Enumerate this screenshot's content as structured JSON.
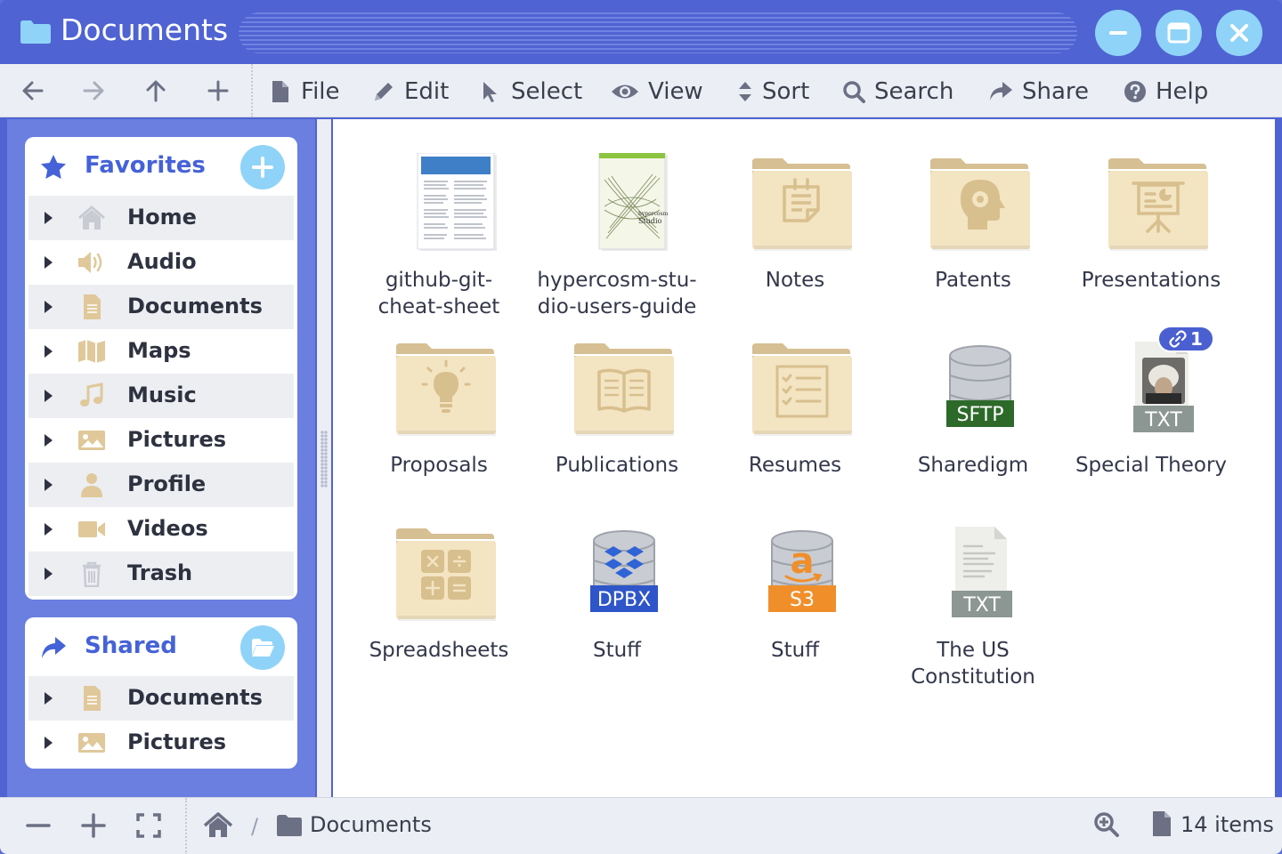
{
  "window": {
    "title": "Documents",
    "title_icon": "folder-icon",
    "controls": [
      "minimize-icon",
      "maximize-icon",
      "close-icon"
    ]
  },
  "toolbar": {
    "nav": [
      "back-icon",
      "forward-icon",
      "up-icon",
      "new-icon"
    ],
    "menus": [
      {
        "label": "File",
        "icon": "file-icon"
      },
      {
        "label": "Edit",
        "icon": "pencil-icon"
      },
      {
        "label": "Select",
        "icon": "cursor-icon"
      },
      {
        "label": "View",
        "icon": "eye-icon"
      },
      {
        "label": "Sort",
        "icon": "sort-icon"
      },
      {
        "label": "Search",
        "icon": "search-icon"
      },
      {
        "label": "Share",
        "icon": "share-icon"
      },
      {
        "label": "Help",
        "icon": "help-icon"
      }
    ]
  },
  "sidebar": {
    "favorites": {
      "title": "Favorites",
      "icon": "star-icon",
      "action_icon": "plus-icon",
      "items": [
        {
          "label": "Home",
          "icon": "home-icon"
        },
        {
          "label": "Audio",
          "icon": "speaker-icon"
        },
        {
          "label": "Documents",
          "icon": "document-icon"
        },
        {
          "label": "Maps",
          "icon": "map-icon"
        },
        {
          "label": "Music",
          "icon": "music-icon"
        },
        {
          "label": "Pictures",
          "icon": "picture-icon"
        },
        {
          "label": "Profile",
          "icon": "person-icon"
        },
        {
          "label": "Videos",
          "icon": "video-icon"
        },
        {
          "label": "Trash",
          "icon": "trash-icon"
        }
      ]
    },
    "shared": {
      "title": "Shared",
      "icon": "share-icon",
      "action_icon": "folder-open-icon",
      "items": [
        {
          "label": "Documents",
          "icon": "document-icon"
        },
        {
          "label": "Pictures",
          "icon": "picture-icon"
        }
      ]
    }
  },
  "files": [
    {
      "label": "github-git-cheat-sheet",
      "label_lines": [
        "github-git-",
        "cheat-sheet"
      ],
      "kind": "pdf-thumbnail"
    },
    {
      "label": "hypercosm-studio-users-guide",
      "label_lines": [
        "hypercosm-stu-",
        "dio-users-guide"
      ],
      "kind": "pdf-thumbnail",
      "thumb_text": [
        "hypercosm",
        "Studio"
      ]
    },
    {
      "label": "Notes",
      "label_lines": [
        "Notes"
      ],
      "kind": "folder",
      "emblem": "notes-icon"
    },
    {
      "label": "Patents",
      "label_lines": [
        "Patents"
      ],
      "kind": "folder",
      "emblem": "brain-gear-icon"
    },
    {
      "label": "Presentations",
      "label_lines": [
        "Presentations"
      ],
      "kind": "folder",
      "emblem": "presentation-icon"
    },
    {
      "label": "Proposals",
      "label_lines": [
        "Proposals"
      ],
      "kind": "folder",
      "emblem": "lightbulb-icon"
    },
    {
      "label": "Publications",
      "label_lines": [
        "Publications"
      ],
      "kind": "folder",
      "emblem": "book-icon"
    },
    {
      "label": "Resumes",
      "label_lines": [
        "Resumes"
      ],
      "kind": "folder",
      "emblem": "checklist-icon"
    },
    {
      "label": "Sharedigm",
      "label_lines": [
        "Sharedigm"
      ],
      "kind": "database",
      "tag": "SFTP",
      "tag_color": "#2d6a2a"
    },
    {
      "label": "Special Theory",
      "label_lines": [
        "Special Theory"
      ],
      "kind": "text-file",
      "tag": "TXT",
      "tag_color": "#8c9794",
      "link_badge": "1"
    },
    {
      "label": "Spreadsheets",
      "label_lines": [
        "Spreadsheets"
      ],
      "kind": "folder",
      "emblem": "calculator-icon"
    },
    {
      "label": "Stuff",
      "label_lines": [
        "Stuff"
      ],
      "kind": "database",
      "tag": "DPBX",
      "tag_color": "#2f56c9",
      "emblem": "dropbox-icon"
    },
    {
      "label": "Stuff",
      "label_lines": [
        "Stuff"
      ],
      "kind": "database",
      "tag": "S3",
      "tag_color": "#f08f2a",
      "emblem": "amazon-icon"
    },
    {
      "label": "The US Constitution",
      "label_lines": [
        "The US",
        "Constitution"
      ],
      "kind": "text-file",
      "tag": "TXT",
      "tag_color": "#8c9794"
    }
  ],
  "statusbar": {
    "zoom_controls": [
      "zoom-out-icon",
      "zoom-in-icon",
      "fullscreen-icon"
    ],
    "path_home_icon": "home-icon",
    "path_separator": "/",
    "path_folder": "Documents",
    "item_count": "14 items"
  },
  "colors": {
    "accent": "#4f63d2",
    "sidebar": "#6a7fe0",
    "button_light": "#8fd3f8",
    "folder": "#f3e4c2",
    "folder_tab": "#d6bf93"
  }
}
